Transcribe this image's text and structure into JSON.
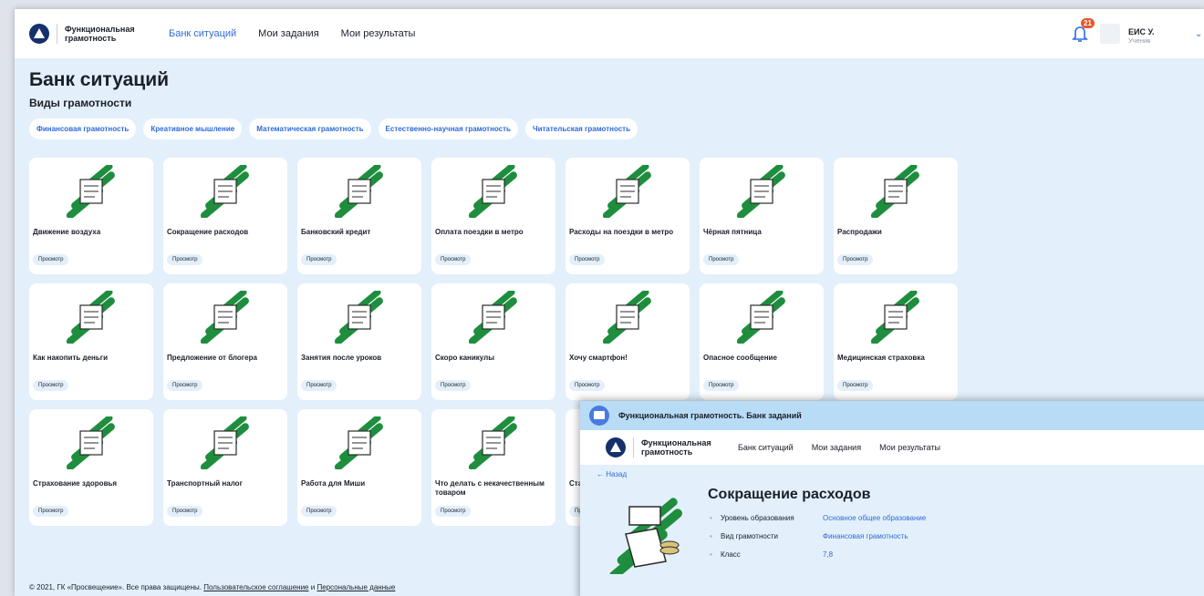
{
  "header": {
    "logo_text": "Функциональная грамотность",
    "nav": [
      "Банк ситуаций",
      "Мои задания",
      "Мои результаты"
    ],
    "notifications": "21",
    "user_name": "ЕИС У.",
    "user_role": "Ученик"
  },
  "page": {
    "title": "Банк ситуаций",
    "subtitle": "Виды грамотности",
    "chips": [
      "Финансовая грамотность",
      "Креативное мышление",
      "Математическая грамотность",
      "Естественно-научная грамотность",
      "Читательская грамотность"
    ],
    "view_label": "Просмотр",
    "cards": [
      "Движение воздуха",
      "Сокращение расходов",
      "Банковский кредит",
      "Оплата поездки в метро",
      "Расходы на поездки в метро",
      "Чёрная пятница",
      "Распродажи",
      "Как накопить деньги",
      "Предложение от блогера",
      "Занятия после уроков",
      "Скоро каникулы",
      "Хочу смартфон!",
      "Опасное сообщение",
      "Медицинская страховка",
      "Страхование здоровья",
      "Транспортный налог",
      "Работа для Миши",
      "Что делать с некачественным товаром",
      "Стар",
      "Пр",
      ""
    ]
  },
  "footer": {
    "copyright": "© 2021, ГК «Просвещение». Все права защищены.",
    "agreement": "Пользовательское соглашение",
    "and": "и",
    "personal": "Персональные данные"
  },
  "overlay": {
    "window_title": "Функциональная грамотность. Банк заданий",
    "back": "← Назад",
    "task_title": "Сокращение расходов",
    "meta": [
      {
        "key": "Уровень образования",
        "value": "Основное общее образование"
      },
      {
        "key": "Вид грамотности",
        "value": "Финансовая грамотность"
      },
      {
        "key": "Класс",
        "value": "7,8"
      }
    ]
  },
  "colors": {
    "accent": "#2f6bd8",
    "art_green": "#1e8e3e",
    "page_bg": "#e3f0fb"
  }
}
